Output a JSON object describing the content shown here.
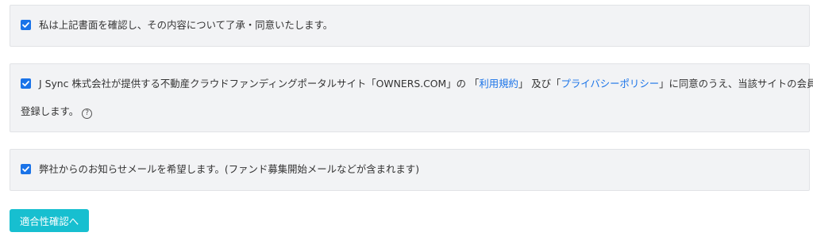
{
  "consents": {
    "first": {
      "checked": true,
      "text": "私は上記書面を確認し、その内容について了承・同意いたします。"
    },
    "second": {
      "checked": true,
      "text_before": "J Sync 株式会社が提供する不動産クラウドファンディングポータルサイト「OWNERS.COM」の 「",
      "terms_link": "利用規約",
      "text_middle": "」 及び「",
      "privacy_link": "プライバシーポリシー",
      "text_after": "」に同意のうえ、当該サイトの会員に",
      "text_line2": "登録します。",
      "help_icon": "?"
    },
    "third": {
      "checked": true,
      "text": "弊社からのお知らせメールを希望します。(ファンド募集開始メールなどが含まれます)"
    }
  },
  "submit_label": "適合性確認へ",
  "colors": {
    "checkbox": "#1a73e8",
    "link": "#1a73e8",
    "button": "#17bfd0",
    "panel_bg": "#f2f3f5"
  }
}
